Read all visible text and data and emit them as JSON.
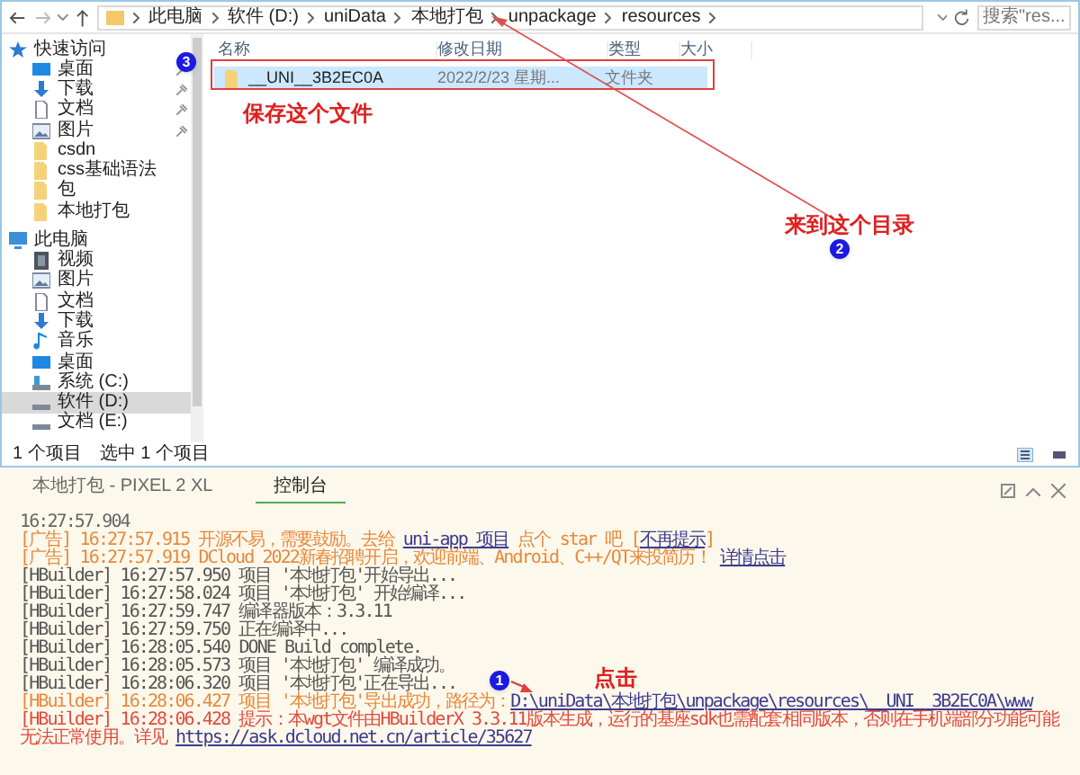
{
  "address_bar": {
    "path": [
      "此电脑",
      "软件 (D:)",
      "uniData",
      "本地打包",
      "unpackage",
      "resources"
    ],
    "search_placeholder": "搜索\"res..."
  },
  "sidebar": {
    "groups": [
      {
        "label": "快速访问",
        "kind": "star",
        "items": [
          {
            "label": "桌面",
            "kind": "desktop",
            "pinned": true,
            "selected": false
          },
          {
            "label": "下载",
            "kind": "download",
            "pinned": true,
            "selected": false
          },
          {
            "label": "文档",
            "kind": "document",
            "pinned": true,
            "selected": false
          },
          {
            "label": "图片",
            "kind": "picture",
            "pinned": true,
            "selected": false
          },
          {
            "label": "csdn",
            "kind": "folder",
            "pinned": false,
            "selected": false
          },
          {
            "label": "css基础语法",
            "kind": "folder",
            "pinned": false,
            "selected": false
          },
          {
            "label": "包",
            "kind": "folder",
            "pinned": false,
            "selected": false
          },
          {
            "label": "本地打包",
            "kind": "folder",
            "pinned": false,
            "selected": false
          }
        ]
      },
      {
        "label": "此电脑",
        "kind": "computer",
        "items": [
          {
            "label": "视频",
            "kind": "video",
            "pinned": false,
            "selected": false
          },
          {
            "label": "图片",
            "kind": "picture",
            "pinned": false,
            "selected": false
          },
          {
            "label": "文档",
            "kind": "document",
            "pinned": false,
            "selected": false
          },
          {
            "label": "下载",
            "kind": "download",
            "pinned": false,
            "selected": false
          },
          {
            "label": "音乐",
            "kind": "music",
            "pinned": false,
            "selected": false
          },
          {
            "label": "桌面",
            "kind": "desktop",
            "pinned": false,
            "selected": false
          },
          {
            "label": "系统 (C:)",
            "kind": "system-drive",
            "pinned": false,
            "selected": false
          },
          {
            "label": "软件 (D:)",
            "kind": "drive",
            "pinned": false,
            "selected": true
          },
          {
            "label": "文档 (E:)",
            "kind": "drive",
            "pinned": false,
            "selected": false
          }
        ]
      }
    ]
  },
  "columns": [
    "名称",
    "修改日期",
    "类型",
    "大小"
  ],
  "files": [
    {
      "name": "__UNI__3B2EC0A",
      "modified": "2022/2/23 星期...",
      "type": "文件夹",
      "selected": true
    }
  ],
  "status_bar": {
    "count": "1 个项目",
    "selection": "选中 1 个项目"
  },
  "console": {
    "tabs": [
      {
        "label": "本地打包 - PIXEL 2 XL",
        "selected": false
      },
      {
        "label": "控制台",
        "selected": true
      }
    ],
    "lines": [
      {
        "kind": "time",
        "segments": [
          {
            "text": "16:27:57.904"
          }
        ]
      },
      {
        "kind": "ad",
        "segments": [
          {
            "text": "[广告] 16:27:57.915 开源不易，需要鼓励。去给 "
          },
          {
            "text": "uni-app 项目",
            "link": true
          },
          {
            "text": " 点个 star 吧 ["
          },
          {
            "text": "不再提示",
            "link": true
          },
          {
            "text": "]"
          }
        ]
      },
      {
        "kind": "ad",
        "segments": [
          {
            "text": "[广告] 16:27:57.919 DCloud 2022新春招聘开启，欢迎前端、Android、C++/QT来投简历！ "
          },
          {
            "text": "详情点击",
            "link": true
          }
        ]
      },
      {
        "kind": "info",
        "segments": [
          {
            "text": "[HBuilder] 16:27:57.950 项目 '本地打包'开始导出..."
          }
        ]
      },
      {
        "kind": "info",
        "segments": [
          {
            "text": "[HBuilder] 16:27:58.024 项目 '本地打包' 开始编译..."
          }
        ]
      },
      {
        "kind": "info",
        "segments": [
          {
            "text": "[HBuilder] 16:27:59.747 编译器版本：3.3.11"
          }
        ]
      },
      {
        "kind": "info",
        "segments": [
          {
            "text": "[HBuilder] 16:27:59.750 正在编译中..."
          }
        ]
      },
      {
        "kind": "info",
        "segments": [
          {
            "text": "[HBuilder] 16:28:05.540  DONE  Build complete."
          }
        ]
      },
      {
        "kind": "info",
        "segments": [
          {
            "text": "[HBuilder] 16:28:05.573 项目 '本地打包' 编译成功。"
          }
        ]
      },
      {
        "kind": "info",
        "segments": [
          {
            "text": "[HBuilder] 16:28:06.320 项目 '本地打包'正在导出..."
          }
        ]
      },
      {
        "kind": "success",
        "segments": [
          {
            "text": "[HBuilder] 16:28:06.427 项目 '本地打包'导出成功，路径为："
          },
          {
            "text": "D:\\uniData\\本地打包\\unpackage\\resources\\__UNI__3B2EC0A\\www",
            "link": true
          }
        ]
      },
      {
        "kind": "warning",
        "segments": [
          {
            "text": "[HBuilder] 16:28:06.428 提示：本wgt文件由HBuilderX 3.3.11版本生成，运行的基座sdk也需配套相同版本，否则在手机端部分功能可能无法正常使用。详见 "
          },
          {
            "text": "https://ask.dcloud.net.cn/article/35627",
            "link": true
          }
        ]
      }
    ]
  },
  "annotations": {
    "badges": [
      "3",
      "2",
      "1"
    ],
    "notes": [
      "保存这个文件",
      "来到这个目录",
      "点击"
    ]
  }
}
